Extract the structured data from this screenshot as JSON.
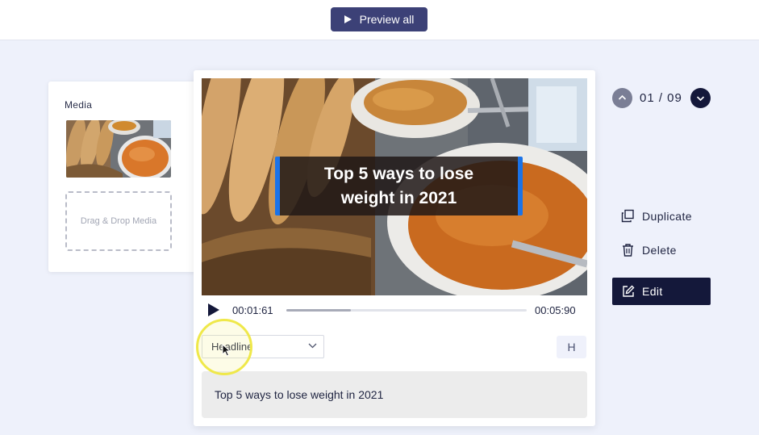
{
  "topbar": {
    "preview_label": "Preview all"
  },
  "media_panel": {
    "title": "Media",
    "dropzone_text": "Drag & Drop Media"
  },
  "player": {
    "caption": "Top 5 ways to lose weight in 2021",
    "current_time": "00:01:61",
    "total_time": "00:05:90",
    "progress": 0.27
  },
  "editor": {
    "style_select_value": "Headline",
    "h_button_label": "H",
    "text_value": "Top 5 ways to lose weight in 2021"
  },
  "nav": {
    "counter": "01 / 09"
  },
  "actions": {
    "duplicate_label": "Duplicate",
    "delete_label": "Delete",
    "edit_label": "Edit"
  },
  "icons": {
    "preview": "play-icon",
    "play": "play-icon",
    "nav_up": "chevron-up-icon",
    "nav_down": "chevron-down-icon",
    "duplicate": "duplicate-icon",
    "delete": "trash-icon",
    "edit": "edit-icon",
    "select": "chevron-down-icon"
  },
  "colors": {
    "primary_dark": "#14183a",
    "preview_button": "#3c4177",
    "caption_border": "#1b73e8",
    "highlight_ring": "#efe84a"
  }
}
